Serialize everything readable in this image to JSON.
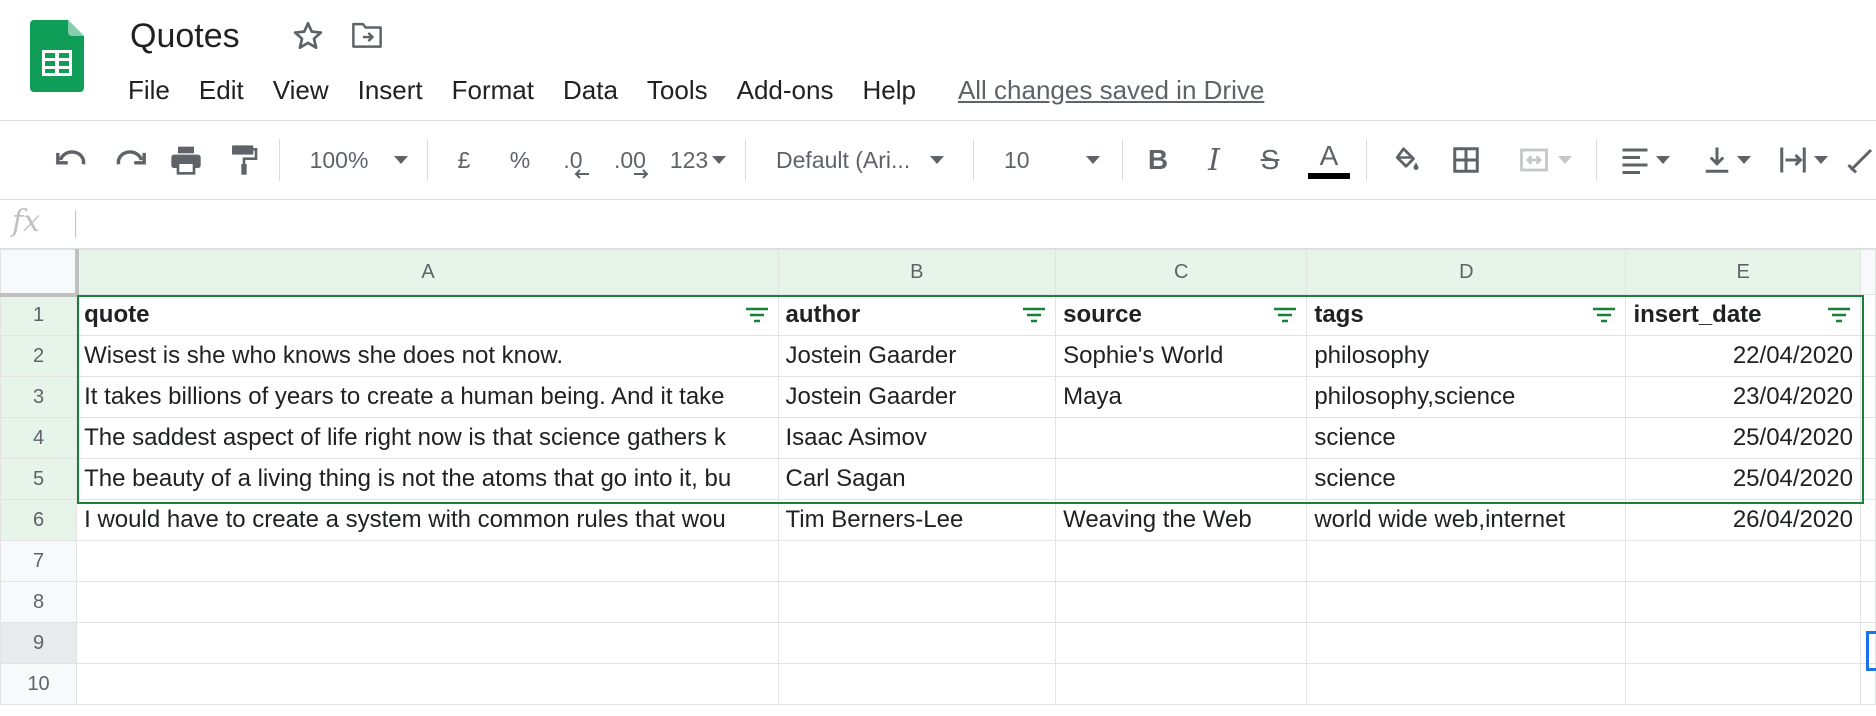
{
  "app": {
    "title": "Quotes",
    "save_status": "All changes saved in Drive",
    "menu": [
      "File",
      "Edit",
      "View",
      "Insert",
      "Format",
      "Data",
      "Tools",
      "Add-ons",
      "Help"
    ]
  },
  "toolbar": {
    "zoom": "100%",
    "currency": "£",
    "percent": "%",
    "decrease_decimals": ".0",
    "increase_decimals": ".00",
    "more_formats": "123",
    "font": "Default (Ari...",
    "font_size": "10",
    "text_color": "#000000"
  },
  "formula_bar": {
    "fx_label": "fx",
    "value": ""
  },
  "grid": {
    "columns": [
      "A",
      "B",
      "C",
      "D",
      "E"
    ],
    "header_row": [
      "quote",
      "author",
      "source",
      "tags",
      "insert_date"
    ],
    "rows": [
      {
        "num": "1"
      },
      {
        "num": "2",
        "cells": [
          "Wisest is she who knows she does not know.",
          "Jostein Gaarder",
          "Sophie's World",
          "philosophy",
          "22/04/2020"
        ]
      },
      {
        "num": "3",
        "cells": [
          "It takes billions of years to create a human being. And it take",
          "Jostein Gaarder",
          "Maya",
          "philosophy,science",
          "23/04/2020"
        ]
      },
      {
        "num": "4",
        "cells": [
          "The saddest aspect of life right now is that science gathers k",
          "Isaac Asimov",
          "",
          "science",
          "25/04/2020"
        ]
      },
      {
        "num": "5",
        "cells": [
          "The beauty of a living thing is not the atoms that go into it, bu",
          "Carl Sagan",
          "",
          "science",
          "25/04/2020"
        ]
      },
      {
        "num": "6",
        "cells": [
          "I would have to create a system with common rules that wou",
          "Tim Berners-Lee",
          "Weaving the Web",
          "world wide web,internet",
          "26/04/2020"
        ]
      },
      {
        "num": "7"
      },
      {
        "num": "8"
      },
      {
        "num": "9"
      },
      {
        "num": "10"
      }
    ]
  },
  "colors": {
    "brand_green": "#0f9d58",
    "selection_green": "#188038",
    "active_blue": "#1a73e8",
    "header_selected_bg": "#e6f4ea"
  }
}
